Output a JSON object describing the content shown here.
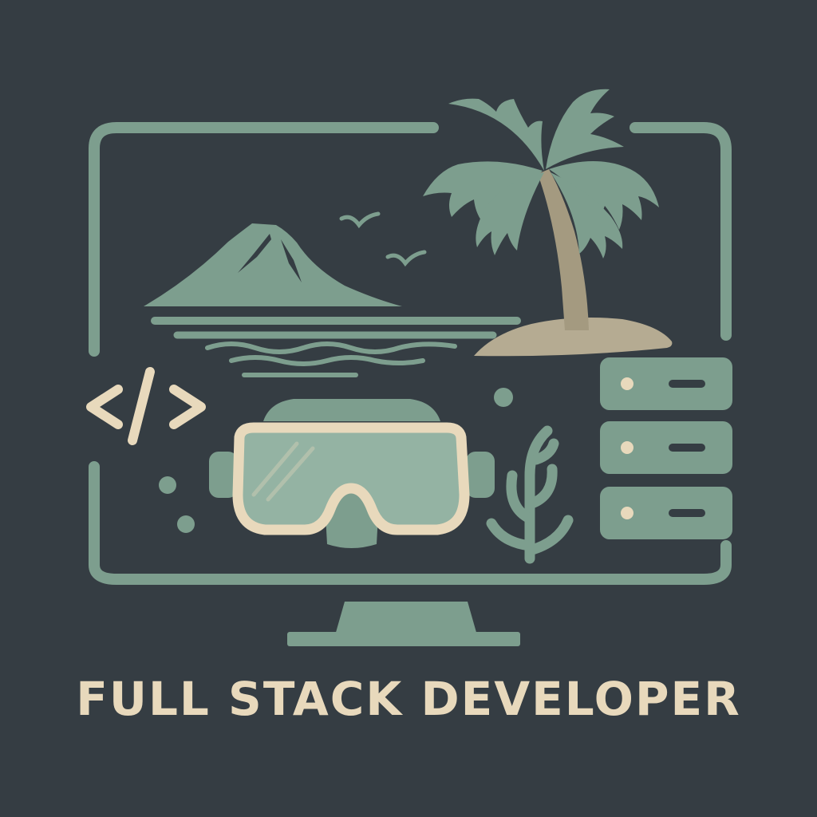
{
  "title": "FULL STACK DEVELOPER",
  "colors": {
    "background": "#353d43",
    "sage": "#7d9e8e",
    "sage_light": "#94b3a3",
    "sand": "#e8d9bc",
    "tan": "#b5ab92",
    "bark": "#a49a80"
  },
  "icons": [
    "monitor-icon",
    "volcano-island-icon",
    "palm-tree-icon",
    "seagull-icon",
    "ocean-waves-icon",
    "code-brackets-icon",
    "diving-mask-icon",
    "coral-icon",
    "server-rack-icon",
    "bubble-icon"
  ]
}
